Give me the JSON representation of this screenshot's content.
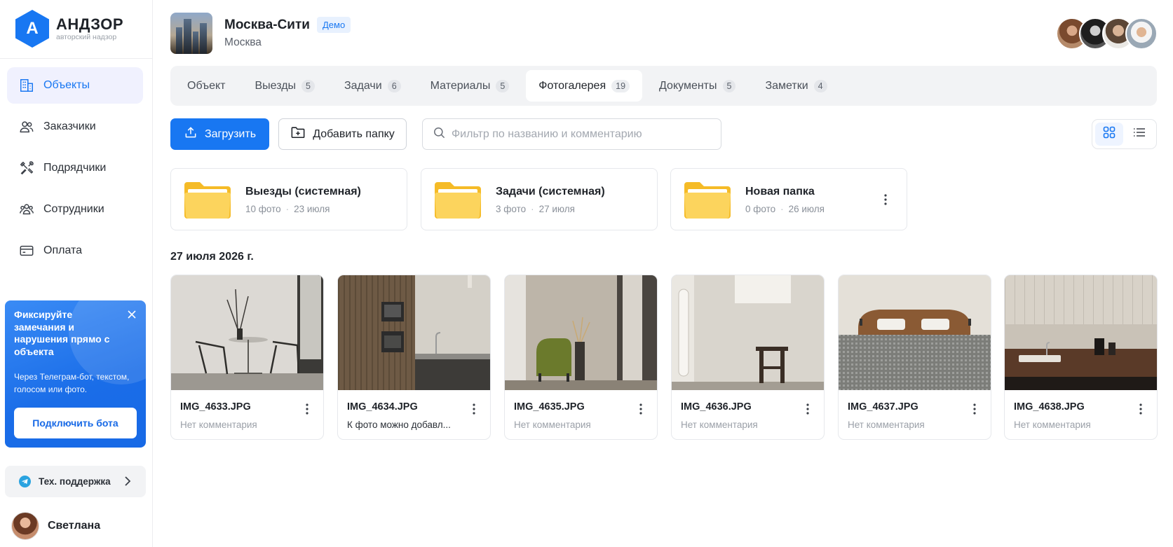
{
  "brand": {
    "logo_letter": "А",
    "name": "АНДЗОР",
    "tagline": "авторский надзор",
    "color": "#1877f2"
  },
  "sidebar": {
    "items": [
      {
        "label": "Объекты",
        "icon": "building-icon",
        "active": true
      },
      {
        "label": "Заказчики",
        "icon": "users-icon",
        "active": false
      },
      {
        "label": "Подрядчики",
        "icon": "tools-icon",
        "active": false
      },
      {
        "label": "Сотрудники",
        "icon": "team-icon",
        "active": false
      },
      {
        "label": "Оплата",
        "icon": "card-icon",
        "active": false
      }
    ],
    "promo": {
      "title": "Фиксируйте замечания и нарушения прямо с объекта",
      "text": "Через Телеграм-бот, текстом, голосом или фото.",
      "button": "Подключить бота"
    },
    "support_label": "Тех. поддержка",
    "user_name": "Светлана"
  },
  "header": {
    "object_name": "Москва-Сити",
    "badge": "Демо",
    "city": "Москва"
  },
  "tabs": [
    {
      "label": "Объект",
      "count": ""
    },
    {
      "label": "Выезды",
      "count": "5"
    },
    {
      "label": "Задачи",
      "count": "6"
    },
    {
      "label": "Материалы",
      "count": "5"
    },
    {
      "label": "Фотогалерея",
      "count": "19",
      "active": true
    },
    {
      "label": "Документы",
      "count": "5"
    },
    {
      "label": "Заметки",
      "count": "4"
    }
  ],
  "toolbar": {
    "upload_label": "Загрузить",
    "add_folder_label": "Добавить папку",
    "search_placeholder": "Фильтр по названию и комментарию"
  },
  "folders": [
    {
      "name": "Выезды (системная)",
      "count": "10 фото",
      "date": "23 июля"
    },
    {
      "name": "Задачи (системная)",
      "count": "3 фото",
      "date": "27 июля"
    },
    {
      "name": "Новая папка",
      "count": "0 фото",
      "date": "26 июля"
    }
  ],
  "gallery": {
    "date_heading": "27 июля 2026 г.",
    "photos": [
      {
        "name": "IMG_4633.JPG",
        "comment": "Нет комментария"
      },
      {
        "name": "IMG_4634.JPG",
        "comment": "К фото можно добавл..."
      },
      {
        "name": "IMG_4635.JPG",
        "comment": "Нет комментария"
      },
      {
        "name": "IMG_4636.JPG",
        "comment": "Нет комментария"
      },
      {
        "name": "IMG_4637.JPG",
        "comment": "Нет комментария"
      },
      {
        "name": "IMG_4638.JPG",
        "comment": "Нет комментария"
      }
    ]
  }
}
